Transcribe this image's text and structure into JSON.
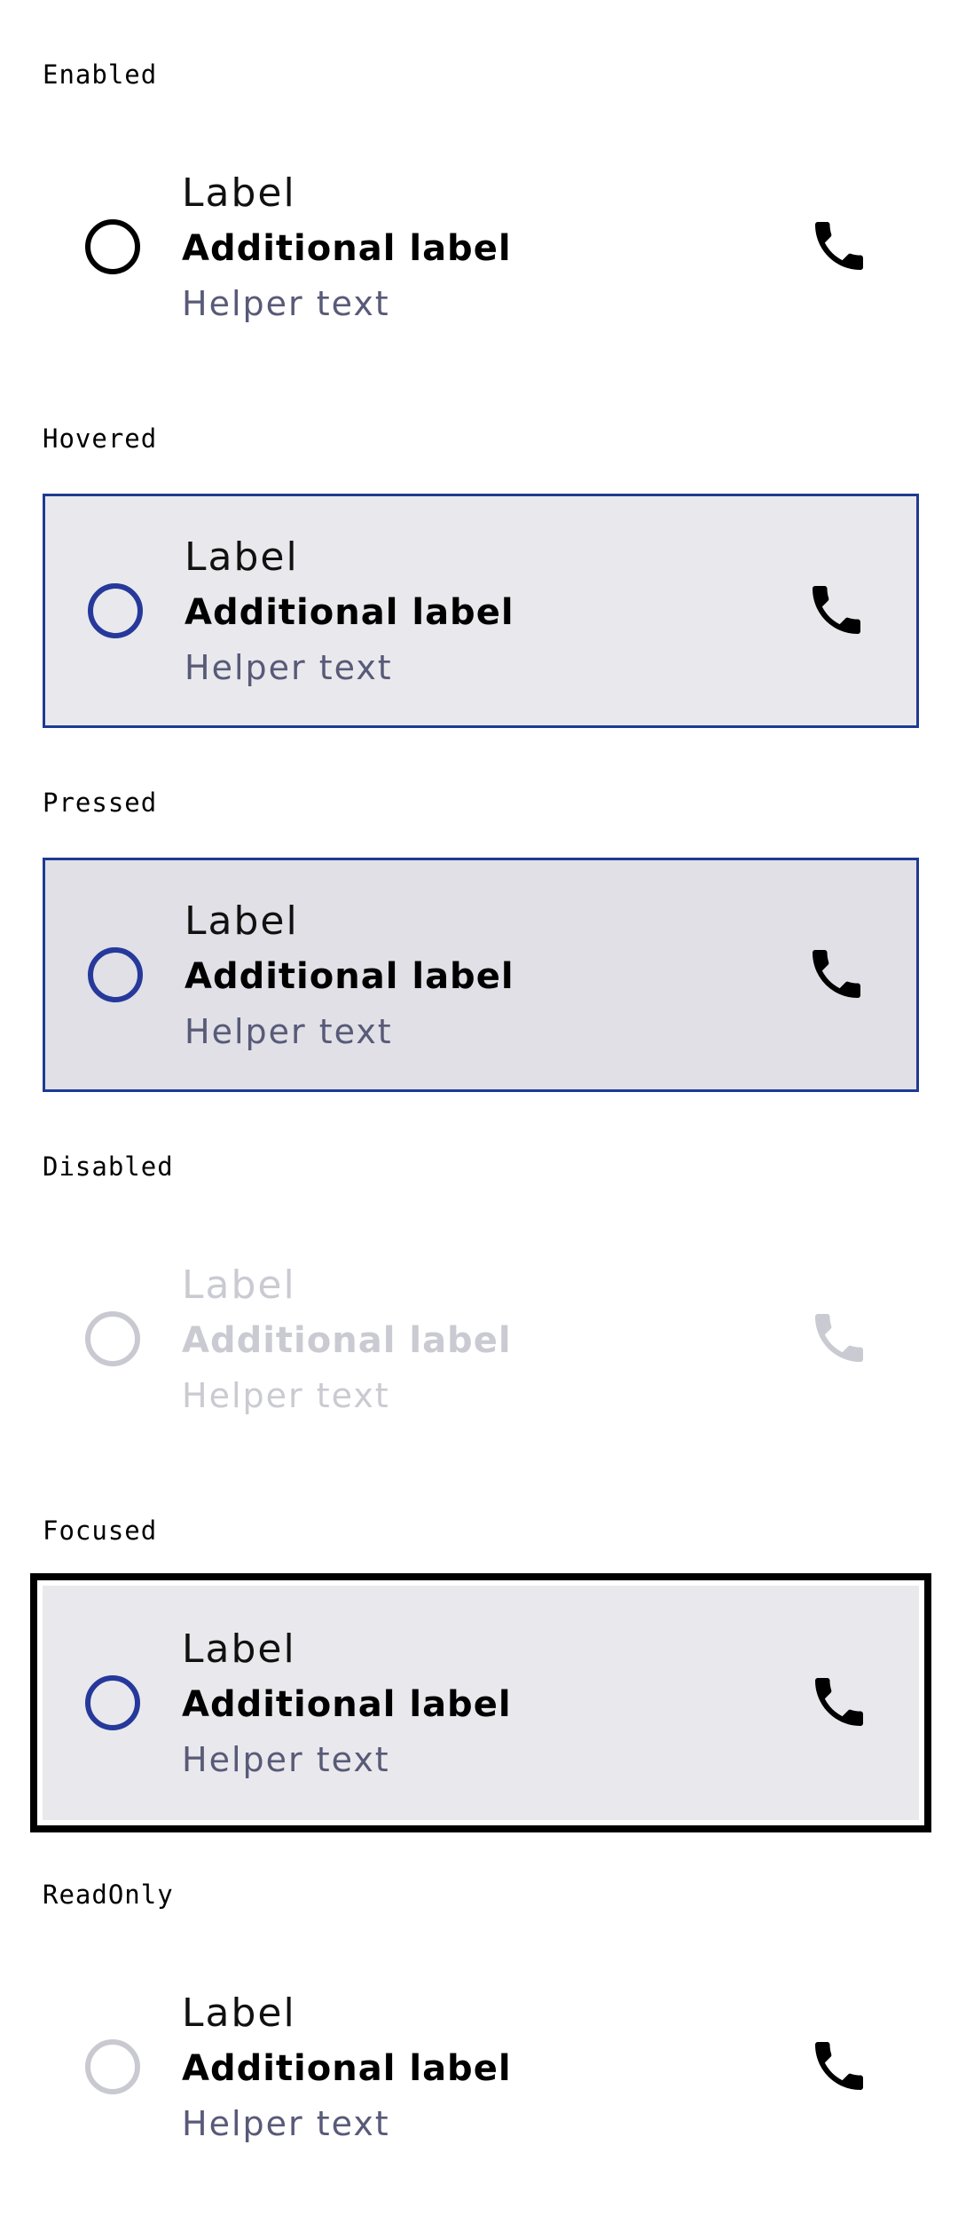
{
  "states": [
    {
      "title": "Enabled",
      "label": "Label",
      "additional_label": "Additional label",
      "helper": "Helper text"
    },
    {
      "title": "Hovered",
      "label": "Label",
      "additional_label": "Additional label",
      "helper": "Helper text"
    },
    {
      "title": "Pressed",
      "label": "Label",
      "additional_label": "Additional label",
      "helper": "Helper text"
    },
    {
      "title": "Disabled",
      "label": "Label",
      "additional_label": "Additional label",
      "helper": "Helper text"
    },
    {
      "title": "Focused",
      "label": "Label",
      "additional_label": "Additional label",
      "helper": "Helper text"
    },
    {
      "title": "ReadOnly",
      "label": "Label",
      "additional_label": "Additional label",
      "helper": "Helper text"
    }
  ],
  "colors": {
    "accent_blue": "#1f3a93",
    "hover_bg": "#e9e9ed",
    "pressed_bg": "#e0e0e6",
    "helper_text": "#585a78",
    "disabled": "#cacad2"
  },
  "icons": {
    "trailing": "phone-icon",
    "leading": "radio-icon"
  }
}
